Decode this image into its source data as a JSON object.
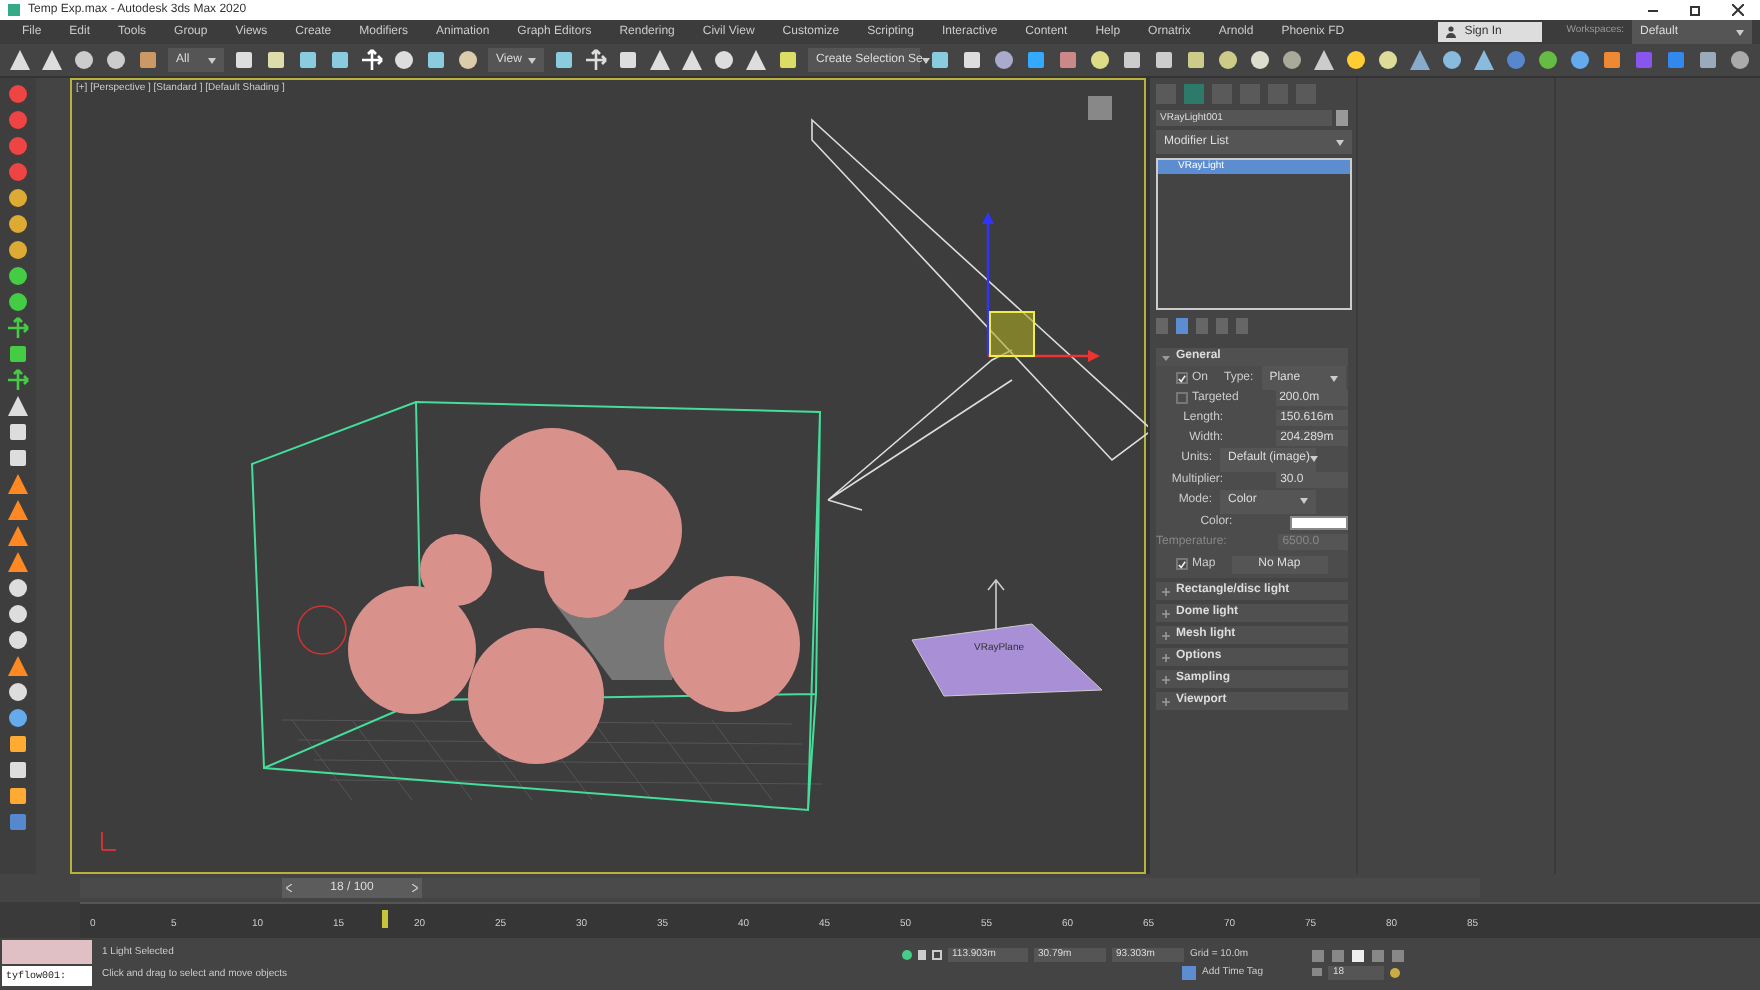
{
  "window": {
    "title": "Temp Exp.max - Autodesk 3ds Max 2020"
  },
  "menu": [
    "File",
    "Edit",
    "Tools",
    "Group",
    "Views",
    "Create",
    "Modifiers",
    "Animation",
    "Graph Editors",
    "Rendering",
    "Civil View",
    "Customize",
    "Scripting",
    "Interactive",
    "Content",
    "Help",
    "Ornatrix",
    "Arnold",
    "Phoenix FD"
  ],
  "account": {
    "sign_in": "Sign In",
    "workspaces_label": "Workspaces:",
    "workspace": "Default"
  },
  "toolbar": {
    "selection_filter": "All",
    "reference_coord": "View",
    "named_selection": "Create Selection Se"
  },
  "viewport": {
    "label": "[+] [Perspective ] [Standard ] [Default Shading ]",
    "plane_label": "VRayPlane"
  },
  "command_panel": {
    "tabs": [
      {
        "selected": false
      },
      {
        "selected": true
      },
      {
        "selected": false
      },
      {
        "selected": false
      },
      {
        "selected": false
      },
      {
        "selected": false
      }
    ],
    "object_name": "VRayLight001",
    "modifier_list": "Modifier List",
    "stack": [
      {
        "label": "VRayLight",
        "selected": true
      }
    ],
    "rollouts": [
      {
        "title": "General",
        "expanded": true,
        "params": [
          {
            "kind": "check_dropdown",
            "check_label": "On",
            "checked": true,
            "label": "Type:",
            "value": "Plane"
          },
          {
            "kind": "check_spinner",
            "check_label": "Targeted",
            "checked": false,
            "value": "200.0m"
          },
          {
            "kind": "spinner",
            "label": "Length:",
            "value": "150.616m"
          },
          {
            "kind": "spinner",
            "label": "Width:",
            "value": "204.289m"
          },
          {
            "kind": "dropdown",
            "label": "Units:",
            "value": "Default (image)"
          },
          {
            "kind": "spinner",
            "label": "Multiplier:",
            "value": "30.0"
          },
          {
            "kind": "dropdown",
            "label": "Mode:",
            "value": "Color"
          },
          {
            "kind": "color",
            "label": "Color:"
          },
          {
            "kind": "spinner",
            "label": "Temperature:",
            "value": "6500.0",
            "disabled": true
          },
          {
            "kind": "check_button",
            "check_label": "Map",
            "checked": true,
            "value": "No Map"
          }
        ]
      },
      {
        "title": "Rectangle/disc light",
        "expanded": false
      },
      {
        "title": "Dome light",
        "expanded": false
      },
      {
        "title": "Mesh light",
        "expanded": false
      },
      {
        "title": "Options",
        "expanded": false
      },
      {
        "title": "Sampling",
        "expanded": false
      },
      {
        "title": "Viewport",
        "expanded": false
      }
    ]
  },
  "timeline": {
    "frame_label": "18 / 100",
    "level": 0.18,
    "ticks": [
      "0",
      "5",
      "10",
      "15",
      "20",
      "25",
      "30",
      "35",
      "40",
      "45",
      "50",
      "55",
      "60",
      "65",
      "70",
      "75",
      "80",
      "85"
    ]
  },
  "status": {
    "script_field": "tyflow001:",
    "selection": "1 Light Selected",
    "prompt": "Click and drag to select and move objects",
    "x": "113.903m",
    "y": "30.79m",
    "z": "93.303m",
    "grid": "Grid = 10.0m",
    "time_tag": "Add Time Tag",
    "frame": "18"
  }
}
